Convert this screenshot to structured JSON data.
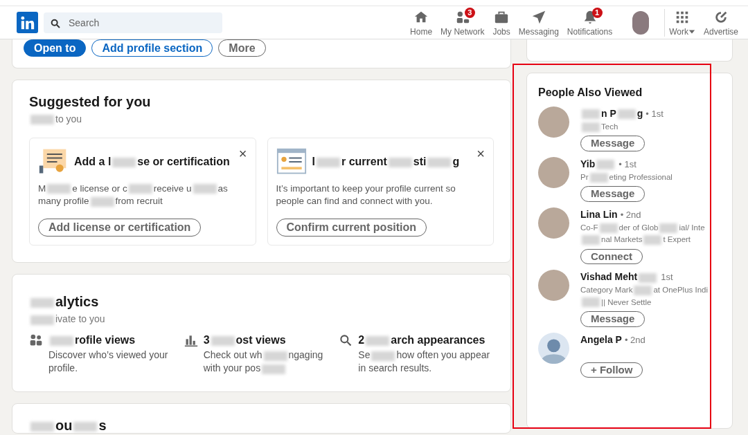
{
  "nav": {
    "search": {
      "placeholder": "Search"
    },
    "items": [
      {
        "kind": "home",
        "label": "Home"
      },
      {
        "kind": "network",
        "label": "My Network",
        "badge": "3"
      },
      {
        "kind": "jobs",
        "label": "Jobs"
      },
      {
        "kind": "messaging",
        "label": "Messaging"
      },
      {
        "kind": "notifications",
        "label": "Notifications",
        "badge": "1"
      },
      {
        "kind": "me"
      },
      {
        "kind": "work",
        "label": "Work"
      },
      {
        "kind": "advertise",
        "label": "Advertise"
      }
    ]
  },
  "profile_actions": [
    {
      "kind": "primary",
      "label": "Open to"
    },
    {
      "kind": "outline-primary",
      "label": "Add profile section"
    },
    {
      "kind": "outline",
      "label": "More"
    }
  ],
  "suggested": {
    "title": "Suggested for you",
    "subtitle": {
      "parts": [
        "to you"
      ],
      "blur_start": true
    },
    "cards": [
      {
        "kind": "certificate",
        "title": {
          "parts": [
            "Add a l",
            "se or certification"
          ]
        },
        "close": "×",
        "desc": {
          "parts": [
            "M",
            "e license or c",
            "receive u",
            "as many profile",
            "from recruit"
          ]
        },
        "button": "Add license or certification"
      },
      {
        "kind": "position",
        "title": {
          "parts": [
            "I",
            "r current",
            "sti",
            "g"
          ]
        },
        "close": "×",
        "desc": {
          "parts": [
            "It’s important to keep your profile current so people can find and connect with you."
          ]
        },
        "button": "Confirm current position"
      }
    ]
  },
  "analytics": {
    "title": {
      "parts": [
        "alytics"
      ],
      "blur_start": true
    },
    "subtitle": {
      "parts": [
        "ivate to you"
      ],
      "blur_start": true
    },
    "items": [
      {
        "kind": "people",
        "title": {
          "parts": [
            "rofile views"
          ],
          "blur_start": true
        },
        "desc": {
          "parts": [
            "Discover who’s viewed your profile."
          ]
        }
      },
      {
        "kind": "chart",
        "title": {
          "parts": [
            "3",
            "ost views"
          ]
        },
        "desc": {
          "parts": [
            "Check out wh",
            "ngaging with your pos"
          ],
          "blur_end": true
        }
      },
      {
        "kind": "search",
        "title": {
          "parts": [
            "2",
            "arch appearances"
          ]
        },
        "desc": {
          "parts": [
            "Se",
            "how often you appear in search results."
          ]
        }
      }
    ]
  },
  "next_section": {
    "title": {
      "parts": [
        "ou",
        "s"
      ],
      "blur_start": true
    }
  },
  "people_also_viewed": {
    "title": "People Also Viewed",
    "people": [
      {
        "name": {
          "parts": [
            "n P",
            "g"
          ],
          "blur_start": true
        },
        "degree": "• 1st",
        "headline": {
          "parts": [
            "Tech"
          ],
          "blur_start": true
        },
        "has_photo": true,
        "button": "Message"
      },
      {
        "name": {
          "parts": [
            "Yib"
          ],
          "blur_end": true
        },
        "degree": "• 1st",
        "headline": {
          "parts": [
            "Pr",
            "eting Professional"
          ]
        },
        "has_photo": true,
        "button": "Message"
      },
      {
        "name": {
          "parts": [
            "Lina Lin"
          ]
        },
        "degree": "• 2nd",
        "headline": {
          "parts": [
            "Co-F",
            "der of Glob",
            "ial/ Inte",
            "nal Markets",
            "t Expert"
          ]
        },
        "has_photo": true,
        "button": "Connect"
      },
      {
        "name": {
          "parts": [
            "Vishad Meht"
          ],
          "blur_end": true
        },
        "degree": "1st",
        "headline": {
          "parts": [
            "Category Mark",
            "at OnePlus Indi",
            "|| Never Settle"
          ]
        },
        "has_photo": true,
        "button": "Message"
      },
      {
        "name": {
          "parts": [
            "Angela P"
          ]
        },
        "degree": "• 2nd",
        "has_photo": false,
        "button": "+ Follow"
      }
    ]
  },
  "annotation": {
    "kind": "rectangle",
    "color": "#e60012"
  }
}
